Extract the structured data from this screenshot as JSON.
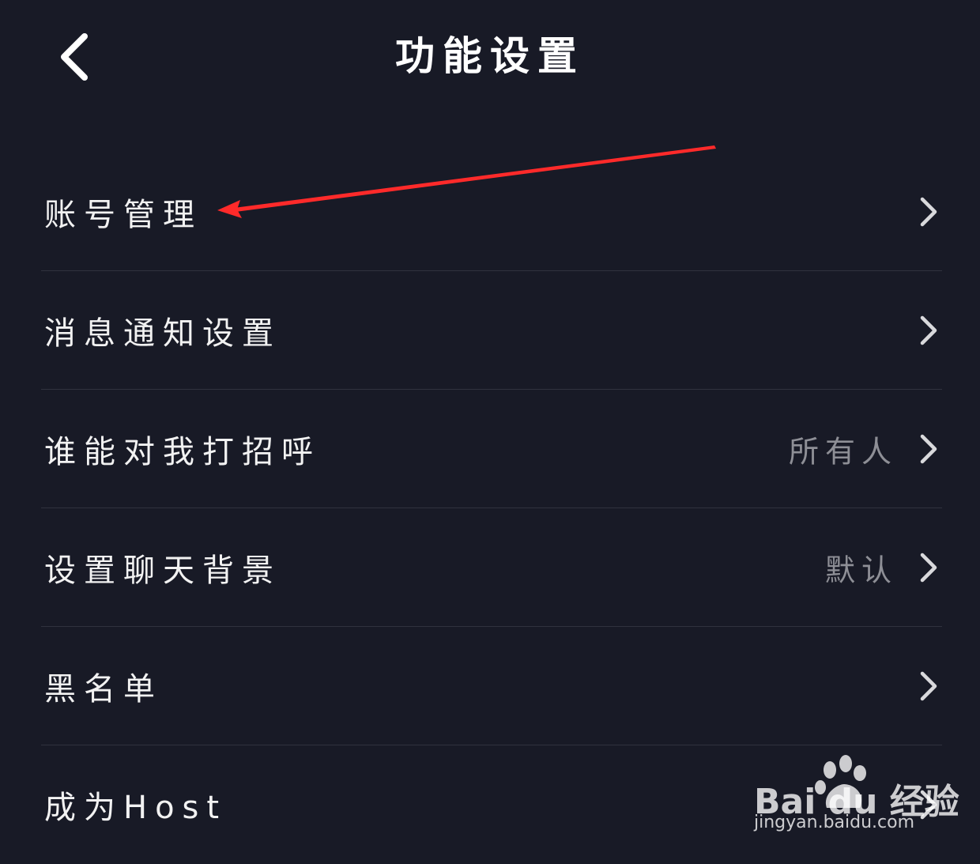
{
  "header": {
    "title": "功能设置",
    "back_icon": "chevron-left-icon"
  },
  "settings": {
    "items": [
      {
        "label": "账号管理",
        "value": "",
        "icon": "chevron-right-icon"
      },
      {
        "label": "消息通知设置",
        "value": "",
        "icon": "chevron-right-icon"
      },
      {
        "label": "谁能对我打招呼",
        "value": "所有人",
        "icon": "chevron-right-icon"
      },
      {
        "label": "设置聊天背景",
        "value": "默认",
        "icon": "chevron-right-icon"
      },
      {
        "label": "黑名单",
        "value": "",
        "icon": "chevron-right-icon"
      },
      {
        "label": "成为Host",
        "value": "",
        "icon": "chevron-right-icon"
      }
    ]
  },
  "annotation": {
    "color": "#ff2a2a",
    "target": "账号管理"
  },
  "watermark": {
    "brand": "Bai du 经验",
    "url": "jingyan.baidu.com"
  },
  "colors": {
    "background": "#181a26",
    "text": "#f2f2f2",
    "secondary_text": "#8e8f96",
    "divider": "#30323e"
  }
}
